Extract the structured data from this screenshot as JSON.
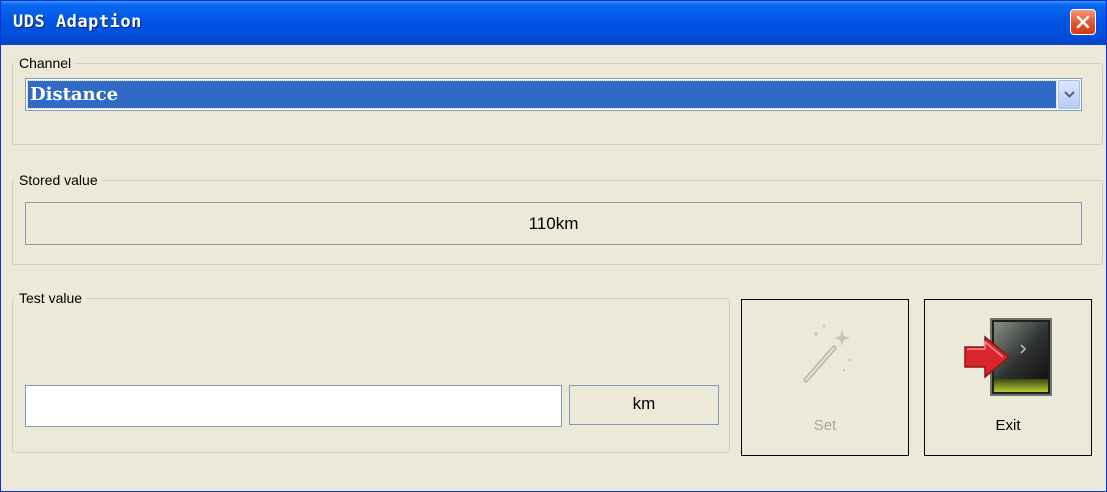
{
  "window": {
    "title": "UDS Adaption"
  },
  "channel": {
    "label": "Channel",
    "selected": "Distance"
  },
  "stored": {
    "label": "Stored value",
    "value": "110km"
  },
  "test": {
    "label": "Test value",
    "input_value": "",
    "unit": "km"
  },
  "buttons": {
    "set": {
      "label": "Set",
      "icon": "wand-icon",
      "enabled": false
    },
    "exit": {
      "label": "Exit",
      "icon": "exit-door-icon",
      "enabled": true
    }
  },
  "colors": {
    "titlebar": "#0055E5",
    "selection": "#316AC5",
    "face": "#ECE9D8",
    "close": "#E2532C"
  }
}
